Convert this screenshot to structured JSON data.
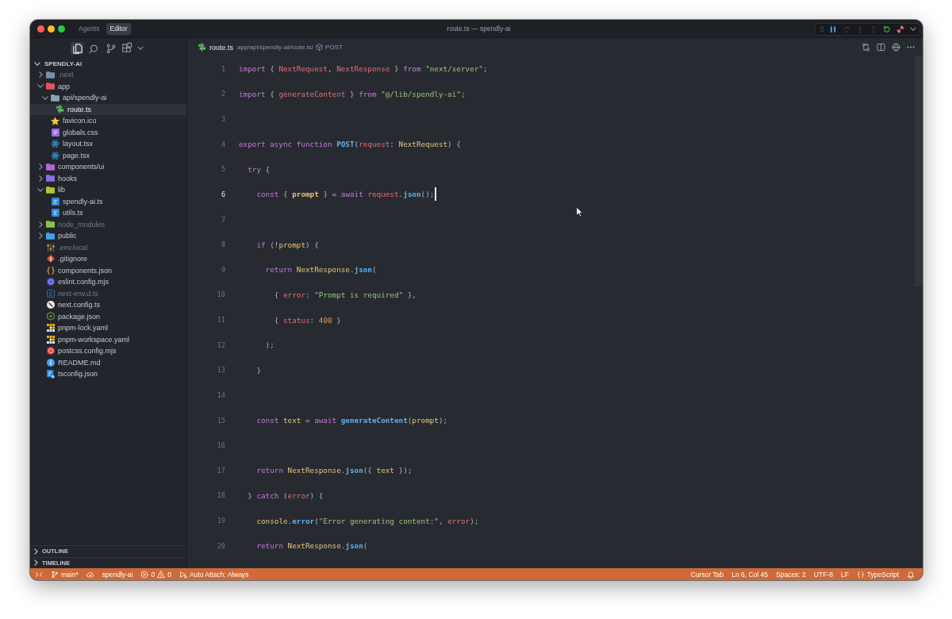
{
  "titlebar": {
    "tabs": [
      {
        "label": "Agents",
        "selected": false
      },
      {
        "label": "Editor",
        "selected": true
      }
    ],
    "title": "route.ts — spendly-ai"
  },
  "debug_toolbar": {
    "buttons": [
      {
        "kind": "pause",
        "disabled": false
      },
      {
        "kind": "step-over",
        "disabled": true
      },
      {
        "kind": "step-into",
        "disabled": true
      },
      {
        "kind": "step-out",
        "disabled": true
      },
      {
        "kind": "restart",
        "disabled": false
      },
      {
        "kind": "disconnect",
        "disabled": false
      }
    ]
  },
  "sidebar": {
    "activity": [
      {
        "kind": "explorer",
        "selected": true
      },
      {
        "kind": "search",
        "selected": false
      },
      {
        "kind": "source-control",
        "selected": false
      },
      {
        "kind": "extensions",
        "selected": false
      }
    ],
    "explorer": {
      "title": "SPENDLY-AI",
      "expanded": true,
      "items": [
        {
          "name": ".next",
          "kind": "folder",
          "color": "#7b8ea8",
          "expanded": false,
          "selected": false,
          "ignored": true
        },
        {
          "name": "app",
          "kind": "folder",
          "color": "#e5545b",
          "expanded": true,
          "selected": false,
          "ignored": false,
          "children": [
            {
              "name": "api/spendly-ai",
              "kind": "folder",
              "color": "#8fa1b3",
              "expanded": true,
              "selected": false,
              "ignored": false,
              "children": [
                {
                  "name": "route.ts",
                  "kind": "route",
                  "selected": true,
                  "ignored": false
                }
              ]
            },
            {
              "name": "favicon.ico",
              "kind": "favicon",
              "selected": false,
              "ignored": false
            },
            {
              "name": "globals.css",
              "kind": "css",
              "selected": false,
              "ignored": false
            },
            {
              "name": "layout.tsx",
              "kind": "tsx",
              "selected": false,
              "ignored": false
            },
            {
              "name": "page.tsx",
              "kind": "tsx",
              "selected": false,
              "ignored": false
            }
          ]
        },
        {
          "name": "components/ui",
          "kind": "folder",
          "color": "#b264d9",
          "expanded": false,
          "selected": false,
          "ignored": false
        },
        {
          "name": "hooks",
          "kind": "folder",
          "color": "#8c6fe0",
          "expanded": false,
          "selected": false,
          "ignored": false
        },
        {
          "name": "lib",
          "kind": "folder",
          "color": "#b5c234",
          "expanded": true,
          "selected": false,
          "ignored": false,
          "children": [
            {
              "name": "spendly-ai.ts",
              "kind": "ts",
              "selected": false,
              "ignored": false
            },
            {
              "name": "utils.ts",
              "kind": "ts",
              "selected": false,
              "ignored": false
            }
          ]
        },
        {
          "name": "node_modules",
          "kind": "folder",
          "color": "#8bc34a",
          "expanded": false,
          "selected": false,
          "ignored": true
        },
        {
          "name": "public",
          "kind": "folder",
          "color": "#3fa3ea",
          "expanded": false,
          "selected": false,
          "ignored": false
        },
        {
          "name": ".env.local",
          "kind": "env",
          "selected": false,
          "ignored": true
        },
        {
          "name": ".gitignore",
          "kind": "git",
          "selected": false,
          "ignored": false
        },
        {
          "name": "components.json",
          "kind": "json",
          "selected": false,
          "ignored": false
        },
        {
          "name": "eslint.config.mjs",
          "kind": "eslint",
          "selected": false,
          "ignored": false
        },
        {
          "name": "next-env.d.ts",
          "kind": "dts",
          "selected": false,
          "ignored": true
        },
        {
          "name": "next.config.ts",
          "kind": "next",
          "selected": false,
          "ignored": false
        },
        {
          "name": "package.json",
          "kind": "node",
          "selected": false,
          "ignored": false
        },
        {
          "name": "pnpm-lock.yaml",
          "kind": "pnpm",
          "selected": false,
          "ignored": false
        },
        {
          "name": "pnpm-workspace.yaml",
          "kind": "pnpm",
          "selected": false,
          "ignored": false
        },
        {
          "name": "postcss.config.mjs",
          "kind": "postcss",
          "selected": false,
          "ignored": false
        },
        {
          "name": "README.md",
          "kind": "readme",
          "selected": false,
          "ignored": false
        },
        {
          "name": "tsconfig.json",
          "kind": "tsconfig",
          "selected": false,
          "ignored": false
        }
      ]
    },
    "sections": [
      {
        "title": "OUTLINE",
        "expanded": false
      },
      {
        "title": "TIMELINE",
        "expanded": false
      }
    ]
  },
  "editor": {
    "file": {
      "kind": "route",
      "name": "route.ts"
    },
    "path": "app/api/spendly-ai/route.ts/",
    "symbol": "POST",
    "lines": [
      {
        "number": "1",
        "active": false,
        "tokens": [
          {
            "kind": "keyword",
            "text": "import"
          },
          {
            "kind": "punctuation",
            "text": " { "
          },
          {
            "kind": "variable",
            "text": "NextRequest"
          },
          {
            "kind": "punctuation",
            "text": ", "
          },
          {
            "kind": "variable",
            "text": "NextResponse"
          },
          {
            "kind": "punctuation",
            "text": " } "
          },
          {
            "kind": "keyword",
            "text": "from "
          },
          {
            "kind": "string",
            "text": "\"next/server\""
          },
          {
            "kind": "punctuation",
            "text": ";"
          }
        ]
      },
      {
        "number": "2",
        "active": false,
        "tokens": [
          {
            "kind": "keyword",
            "text": "import"
          },
          {
            "kind": "punctuation",
            "text": " { "
          },
          {
            "kind": "variable",
            "text": "generateContent"
          },
          {
            "kind": "punctuation",
            "text": " } "
          },
          {
            "kind": "keyword",
            "text": "from "
          },
          {
            "kind": "string",
            "text": "\"@/lib/spendly-ai\""
          },
          {
            "kind": "punctuation",
            "text": ";"
          }
        ]
      },
      {
        "number": "3",
        "active": false
      },
      {
        "number": "4",
        "active": false,
        "tokens": [
          {
            "kind": "keyword",
            "text": "export async function "
          },
          {
            "kind": "function",
            "text": "POST"
          },
          {
            "kind": "punctuation",
            "text": "("
          },
          {
            "kind": "variable",
            "text": "request"
          },
          {
            "kind": "punctuation",
            "text": ": "
          },
          {
            "kind": "type",
            "text": "NextRequest"
          },
          {
            "kind": "punctuation",
            "text": ") {"
          }
        ]
      },
      {
        "number": "5",
        "active": false,
        "tokens": [
          {
            "kind": "keyword",
            "text": "  try"
          },
          {
            "kind": "punctuation",
            "text": " {"
          }
        ]
      },
      {
        "number": "6",
        "active": true,
        "tokens": [
          {
            "kind": "keyword",
            "text": "    const"
          },
          {
            "kind": "punctuation",
            "text": " { "
          },
          {
            "kind": "type",
            "text": "prompt"
          },
          {
            "kind": "punctuation",
            "text": " } = "
          },
          {
            "kind": "keyword",
            "text": "await "
          },
          {
            "kind": "variable",
            "text": "request"
          },
          {
            "kind": "punctuation",
            "text": "."
          },
          {
            "kind": "function",
            "text": "json"
          },
          {
            "kind": "punctuation",
            "text": "();"
          }
        ]
      },
      {
        "number": "7",
        "active": false
      },
      {
        "number": "8",
        "active": false,
        "tokens": [
          {
            "kind": "keyword",
            "text": "    if"
          },
          {
            "kind": "punctuation",
            "text": " (!"
          },
          {
            "kind": "type",
            "text": "prompt"
          },
          {
            "kind": "punctuation",
            "text": ") {"
          }
        ]
      },
      {
        "number": "9",
        "active": false,
        "tokens": [
          {
            "kind": "keyword",
            "text": "      return "
          },
          {
            "kind": "type",
            "text": "NextResponse"
          },
          {
            "kind": "punctuation",
            "text": "."
          },
          {
            "kind": "function",
            "text": "json"
          },
          {
            "kind": "punctuation",
            "text": "("
          }
        ]
      },
      {
        "number": "10",
        "active": false,
        "tokens": [
          {
            "kind": "punctuation",
            "text": "        { "
          },
          {
            "kind": "variable",
            "text": "error"
          },
          {
            "kind": "punctuation",
            "text": ": "
          },
          {
            "kind": "string",
            "text": "\"Prompt is required\""
          },
          {
            "kind": "punctuation",
            "text": " },"
          }
        ]
      },
      {
        "number": "11",
        "active": false,
        "tokens": [
          {
            "kind": "punctuation",
            "text": "        { "
          },
          {
            "kind": "variable",
            "text": "status"
          },
          {
            "kind": "punctuation",
            "text": ": "
          },
          {
            "kind": "number",
            "text": "400"
          },
          {
            "kind": "punctuation",
            "text": " }"
          }
        ]
      },
      {
        "number": "12",
        "active": false,
        "tokens": [
          {
            "kind": "punctuation",
            "text": "      );"
          }
        ]
      },
      {
        "number": "13",
        "active": false,
        "tokens": [
          {
            "kind": "punctuation",
            "text": "    }"
          }
        ]
      },
      {
        "number": "14",
        "active": false
      },
      {
        "number": "15",
        "active": false,
        "tokens": [
          {
            "kind": "keyword",
            "text": "    const "
          },
          {
            "kind": "type",
            "text": "text"
          },
          {
            "kind": "punctuation",
            "text": " = "
          },
          {
            "kind": "keyword",
            "text": "await "
          },
          {
            "kind": "function",
            "text": "generateContent"
          },
          {
            "kind": "punctuation",
            "text": "("
          },
          {
            "kind": "type",
            "text": "prompt"
          },
          {
            "kind": "punctuation",
            "text": ");"
          }
        ]
      },
      {
        "number": "16",
        "active": false
      },
      {
        "number": "17",
        "active": false,
        "tokens": [
          {
            "kind": "keyword",
            "text": "    return "
          },
          {
            "kind": "type",
            "text": "NextResponse"
          },
          {
            "kind": "punctuation",
            "text": "."
          },
          {
            "kind": "function",
            "text": "json"
          },
          {
            "kind": "punctuation",
            "text": "({ "
          },
          {
            "kind": "type",
            "text": "text"
          },
          {
            "kind": "punctuation",
            "text": " });"
          }
        ]
      },
      {
        "number": "18",
        "active": false,
        "tokens": [
          {
            "kind": "punctuation",
            "text": "  } "
          },
          {
            "kind": "keyword",
            "text": "catch"
          },
          {
            "kind": "punctuation",
            "text": " ("
          },
          {
            "kind": "variable",
            "text": "error"
          },
          {
            "kind": "punctuation",
            "text": ") {"
          }
        ]
      },
      {
        "number": "19",
        "active": false,
        "tokens": [
          {
            "kind": "type",
            "text": "    console"
          },
          {
            "kind": "punctuation",
            "text": "."
          },
          {
            "kind": "function",
            "text": "error"
          },
          {
            "kind": "punctuation",
            "text": "("
          },
          {
            "kind": "string",
            "text": "\"Error generating content:\""
          },
          {
            "kind": "punctuation",
            "text": ", "
          },
          {
            "kind": "variable",
            "text": "error"
          },
          {
            "kind": "punctuation",
            "text": ");"
          }
        ]
      },
      {
        "number": "20",
        "active": false,
        "tokens": [
          {
            "kind": "keyword",
            "text": "    return "
          },
          {
            "kind": "type",
            "text": "NextResponse"
          },
          {
            "kind": "punctuation",
            "text": "."
          },
          {
            "kind": "function",
            "text": "json"
          },
          {
            "kind": "punctuation",
            "text": "("
          }
        ]
      }
    ]
  },
  "status_bar": {
    "left": [
      {
        "kind": "remote"
      },
      {
        "kind": "branch",
        "text": "main*"
      },
      {
        "kind": "sync"
      },
      {
        "kind": "text",
        "text": "spendly-ai"
      },
      {
        "kind": "problems",
        "errors": "0",
        "warnings": "0"
      },
      {
        "kind": "attach",
        "text": "Auto Attach: Always"
      }
    ],
    "right": [
      {
        "kind": "text",
        "text": "Cursor Tab"
      },
      {
        "kind": "text",
        "text": "Ln 6, Col 45"
      },
      {
        "kind": "text",
        "text": "Spaces: 2"
      },
      {
        "kind": "text",
        "text": "UTF-8"
      },
      {
        "kind": "text",
        "text": "LF"
      },
      {
        "kind": "language",
        "text": "TypeScript"
      },
      {
        "kind": "notifications"
      }
    ]
  }
}
